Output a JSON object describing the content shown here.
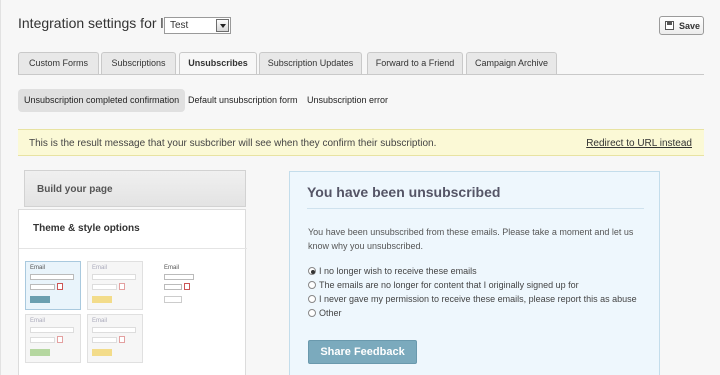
{
  "header": {
    "title": "Integration settings for list",
    "list_select_value": "Test",
    "save_label": "Save"
  },
  "tabs": [
    {
      "label": "Custom Forms",
      "active": false
    },
    {
      "label": "Subscriptions",
      "active": false
    },
    {
      "label": "Unsubscribes",
      "active": true
    },
    {
      "label": "Subscription Updates",
      "active": false
    },
    {
      "label": "Forward to a Friend",
      "active": false
    },
    {
      "label": "Campaign Archive",
      "active": false
    }
  ],
  "subtabs": [
    {
      "label": "Unsubscription completed confirmation",
      "active": true
    },
    {
      "label": "Default unsubscription form",
      "active": false
    },
    {
      "label": "Unsubscription error",
      "active": false
    }
  ],
  "banner": {
    "message": "This is the result message that your susbcriber will see when they confirm their subscription.",
    "link": "Redirect to URL instead"
  },
  "sidebar": {
    "build_label": "Build your page",
    "theme_label": "Theme & style options",
    "thumbnails": [
      {
        "label": "Email",
        "button_color": "#6a9fb0",
        "selected": true
      },
      {
        "label": "Email",
        "button_color": "#f3dc8a",
        "selected": false
      },
      {
        "label": "Email",
        "button_color": "#ffffff",
        "selected": false
      },
      {
        "label": "Email",
        "button_color": "#b5d7a0",
        "selected": false
      },
      {
        "label": "Email",
        "button_color": "#f3dc8a",
        "selected": false
      }
    ]
  },
  "preview": {
    "title": "You have been unsubscribed",
    "body": "You have been unsubscribed from these emails. Please take a moment and let us know why you unsubscribed.",
    "options": [
      {
        "label": "I no longer wish to receive these emails",
        "checked": true
      },
      {
        "label": "The emails are no longer for content that I originally signed up for",
        "checked": false
      },
      {
        "label": "I never gave my permission to receive these emails, please report this as abuse",
        "checked": false
      },
      {
        "label": "Other",
        "checked": false
      }
    ],
    "button_label": "Share Feedback"
  },
  "colors": {
    "banner_bg": "#fbf9d6",
    "preview_bg": "#eef7fd",
    "share_button": "#7baabd"
  }
}
